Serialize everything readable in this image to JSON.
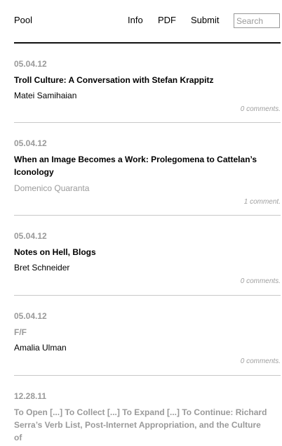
{
  "header": {
    "brand": "Pool",
    "nav": [
      "Info",
      "PDF",
      "Submit"
    ],
    "search_placeholder": "Search"
  },
  "posts": [
    {
      "date": "05.04.12",
      "title": "Troll Culture: A Conversation with Stefan Krappitz",
      "author": "Matei Samihaian",
      "comments": "0 comments."
    },
    {
      "date": "05.04.12",
      "title": "When an Image Becomes a Work: Prolegomena to Cattelan’s Iconology",
      "author": "Domenico Quaranta",
      "comments": "1 comment."
    },
    {
      "date": "05.04.12",
      "title": "Notes on Hell, Blogs",
      "author": "Bret Schneider",
      "comments": "0 comments."
    },
    {
      "date": "05.04.12",
      "title": "F/F",
      "author": "Amalia Ulman",
      "comments": "0 comments."
    },
    {
      "date": "12.28.11",
      "title": "To Open [...] To Collect [...] To Expand [...] To Continue: Richard Serra’s Verb List, Post-Internet Appropriation, and the Culture of",
      "author": "",
      "comments": ""
    }
  ]
}
